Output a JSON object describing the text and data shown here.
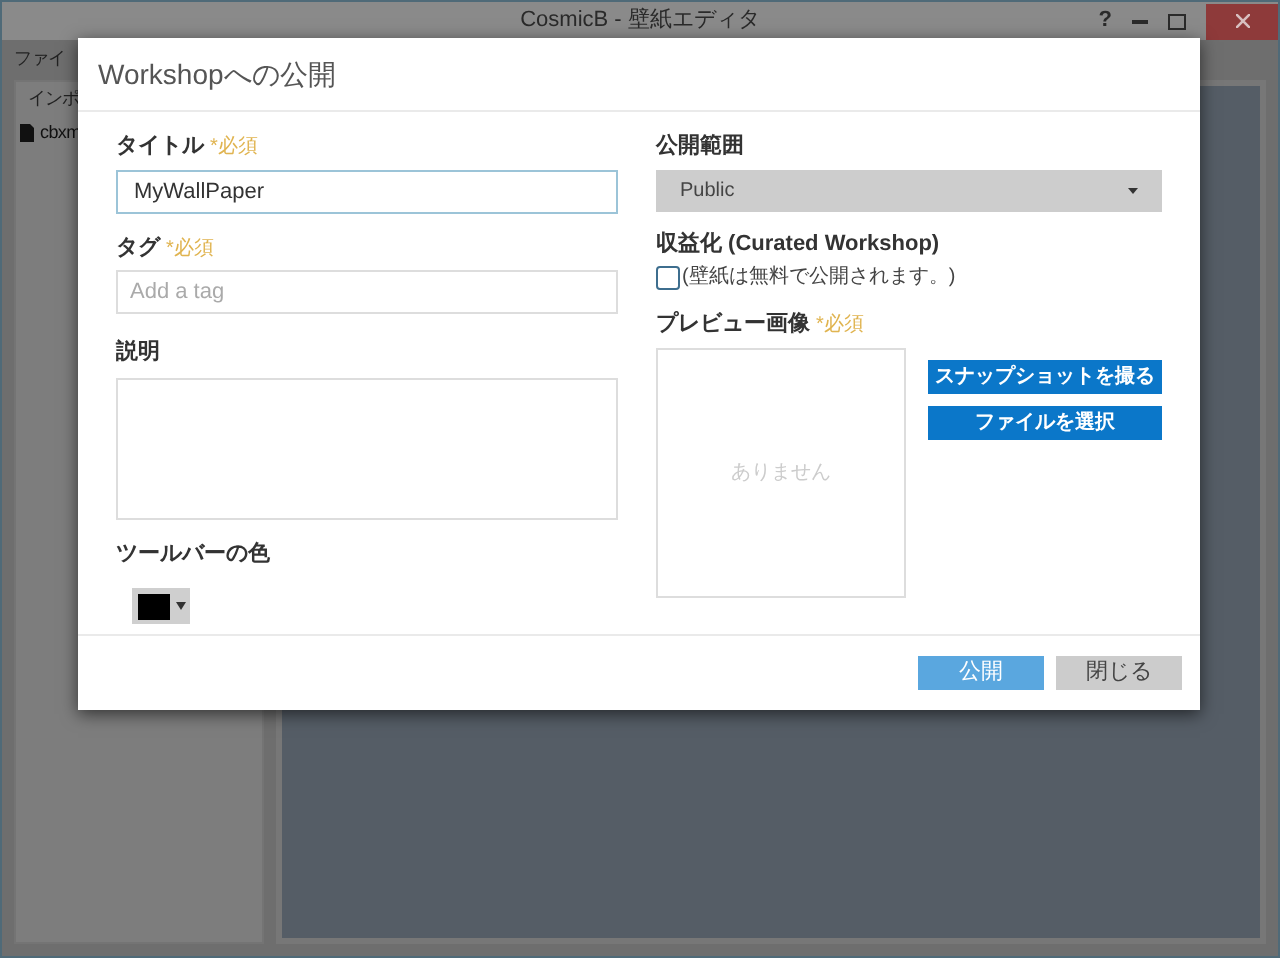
{
  "window": {
    "title": "CosmicB - 壁紙エディタ",
    "help": "?"
  },
  "menu": [
    "ファイ"
  ],
  "sidebar": {
    "tab": "インポ",
    "items": [
      {
        "label": "cbxm"
      }
    ]
  },
  "dialog": {
    "title": "Workshopへの公開",
    "title_field": {
      "label": "タイトル",
      "required": "*必須",
      "value": "MyWallPaper"
    },
    "tag_field": {
      "label": "タグ",
      "required": "*必須",
      "placeholder": "Add a tag"
    },
    "description": {
      "label": "説明"
    },
    "toolbar_color": {
      "label": "ツールバーの色",
      "color": "#000000"
    },
    "visibility": {
      "label": "公開範囲",
      "value": "Public"
    },
    "monetization": {
      "label": "収益化 (Curated Workshop)",
      "checked": false,
      "note": "(壁紙は無料で公開されます。)"
    },
    "preview": {
      "label": "プレビュー画像",
      "required": "*必須",
      "empty_text": "ありません",
      "buttons": [
        "スナップショットを撮る",
        "ファイルを選択"
      ]
    },
    "footer_buttons": [
      {
        "label": "公開",
        "kind": "primary",
        "disabled": true
      },
      {
        "label": "閉じる",
        "kind": "secondary",
        "disabled": false
      }
    ]
  }
}
